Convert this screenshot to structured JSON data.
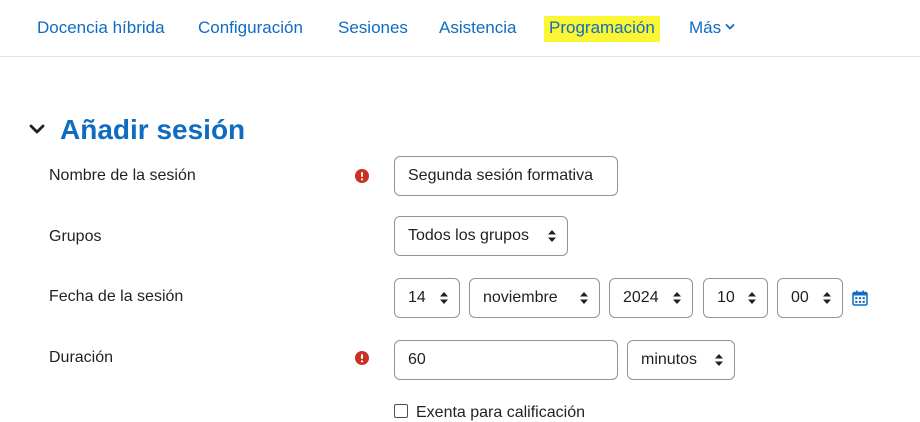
{
  "nav": {
    "items": [
      {
        "label": "Docencia híbrida"
      },
      {
        "label": "Configuración"
      },
      {
        "label": "Sesiones"
      },
      {
        "label": "Asistencia"
      },
      {
        "label": "Programación"
      },
      {
        "label": "Más"
      }
    ],
    "highlight_color": "#faf633",
    "link_color": "#0f6cbf"
  },
  "section": {
    "title": "Añadir sesión",
    "toggle_icon": "chevron-down-icon"
  },
  "form": {
    "session_name": {
      "label": "Nombre de la sesión",
      "value": "Segunda sesión formativa",
      "required": true
    },
    "groups": {
      "label": "Grupos",
      "value": "Todos los grupos"
    },
    "session_date": {
      "label": "Fecha de la sesión",
      "day": "14",
      "month": "noviembre",
      "year": "2024",
      "hour": "10",
      "minute": "00",
      "calendar_icon": "calendar-icon"
    },
    "duration": {
      "label": "Duración",
      "value": "60",
      "unit": "minutos",
      "required": true
    },
    "exempt": {
      "label": "Exenta para calificación",
      "checked": false
    }
  },
  "colors": {
    "required": "#ca3120",
    "border": "#8f959e",
    "text": "#1d2125"
  }
}
